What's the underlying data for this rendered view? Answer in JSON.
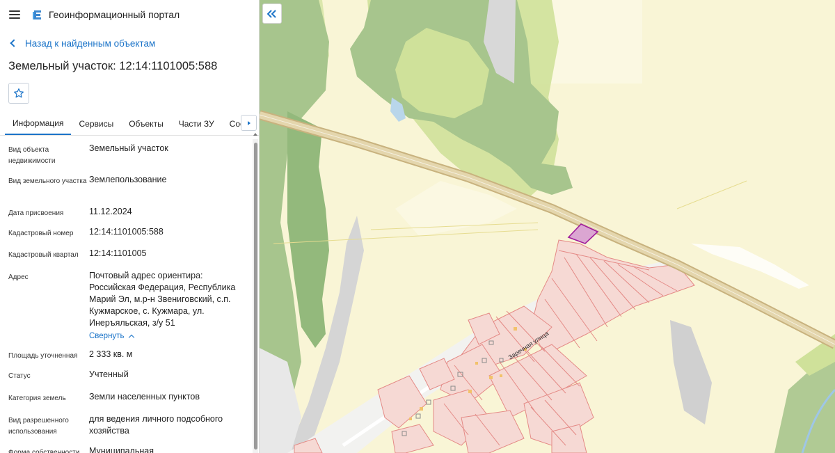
{
  "header": {
    "portal_title": "Геоинформационный портал",
    "menu_icon": "hamburger-icon",
    "logo_icon": "portal-logo-icon"
  },
  "navigation": {
    "back_label": "Назад к найденным объектам"
  },
  "object": {
    "title": "Земельный участок: 12:14:1101005:588"
  },
  "tabs": [
    {
      "label": "Информация",
      "active": true
    },
    {
      "label": "Сервисы",
      "active": false
    },
    {
      "label": "Объекты",
      "active": false
    },
    {
      "label": "Части ЗУ",
      "active": false
    },
    {
      "label": "Состав",
      "active": false
    }
  ],
  "properties": [
    {
      "key": "Вид объекта недвижимости",
      "value": "Земельный участок"
    },
    {
      "key": "Вид земельного участка",
      "value": "Землепользование"
    },
    {
      "key": "Дата присвоения",
      "value": "11.12.2024"
    },
    {
      "key": "Кадастровый номер",
      "value": "12:14:1101005:588"
    },
    {
      "key": "Кадастровый квартал",
      "value": "12:14:1101005"
    },
    {
      "key": "Адрес",
      "value": "Почтовый адрес ориентира: Российская Федерация, Республика Марий Эл, м.р-н Звениговский, с.п. Кужмарское, с. Кужмара, ул. Инеръяльская, з/у 51",
      "toggle": "Свернуть"
    },
    {
      "key": "Площадь уточненная",
      "value": "2 333 кв. м"
    },
    {
      "key": "Статус",
      "value": "Учтенный"
    },
    {
      "key": "Категория земель",
      "value": "Земли населенных пунктов"
    },
    {
      "key": "Вид разрешенного использования",
      "value": "для ведения личного подсобного хозяйства"
    },
    {
      "key": "Форма собственности",
      "value": "Муниципальная"
    }
  ],
  "map": {
    "street_label": "Заречная улица",
    "colors": {
      "background": "#f9f5d6",
      "forest": "#a7c58d",
      "meadow": "#cfe19a",
      "road": "#d9c9a3",
      "parcel_fill": "#f6d9d4",
      "parcel_stroke": "#e48a86",
      "selected_parcel": "#a01d9c",
      "accent": "#1a73c8"
    }
  }
}
